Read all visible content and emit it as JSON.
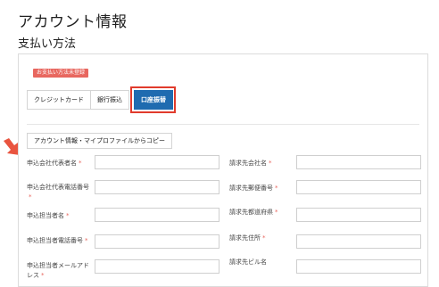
{
  "page": {
    "title": "アカウント情報",
    "section": "支払い方法"
  },
  "badge": "お支払い方法未登録",
  "tabs": [
    {
      "label": "クレジットカード",
      "active": false
    },
    {
      "label": "銀行振込",
      "active": false
    },
    {
      "label": "口座振替",
      "active": true
    }
  ],
  "copy_button": "アカウント情報・マイプロファイルからコピー",
  "form": {
    "left": [
      {
        "label": "申込会社代表者名",
        "value": ""
      },
      {
        "label": "申込会社代表電話番号",
        "value": ""
      },
      {
        "label": "申込担当者名",
        "value": ""
      },
      {
        "label": "申込担当者電話番号",
        "value": ""
      },
      {
        "label": "申込担当者メールアドレス",
        "value": ""
      }
    ],
    "right": [
      {
        "label": "請求先会社名",
        "value": ""
      },
      {
        "label": "請求先郵便番号",
        "value": ""
      },
      {
        "label": "請求先都道府県",
        "value": ""
      },
      {
        "label": "請求先住所",
        "value": ""
      },
      {
        "label": "請求先ビル名",
        "value": ""
      }
    ],
    "required_mark": "*"
  },
  "colors": {
    "accent": "#1f6bb0",
    "highlight": "#e13b2c",
    "badge": "#e8675f",
    "arrow": "#e9543f"
  }
}
